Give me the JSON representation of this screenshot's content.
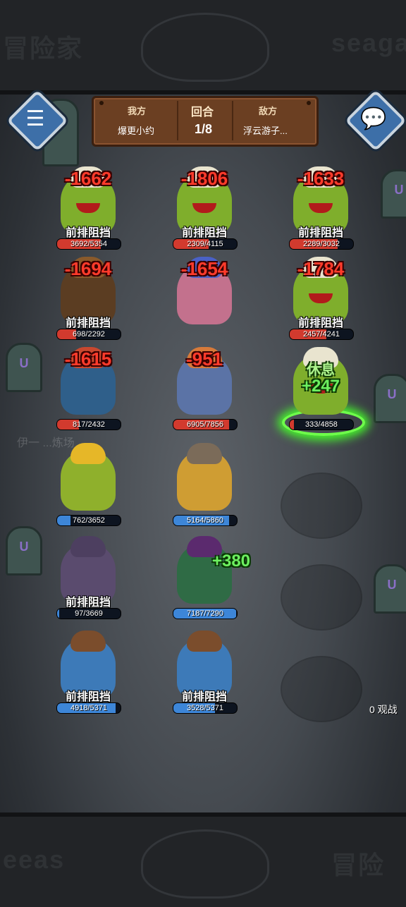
{
  "header": {
    "my_side_label": "我方",
    "round_label": "回合",
    "enemy_side_label": "敌方",
    "my_player": "爆更小约",
    "round_value": "1/8",
    "enemy_player": "浮云游子..."
  },
  "buttons": {
    "menu_icon": "menu-icon",
    "chat_icon": "chat-bubble-icon"
  },
  "spectators_label": "0 观战",
  "watermark_text": "伊一 ...炼场",
  "frame_text": {
    "left_top": "冒险家",
    "right_top": "seaga",
    "left_bottom": "eeas",
    "right_bottom": "冒险"
  },
  "status_texts": {
    "taunt": "前排阻挡",
    "rest": "休息"
  },
  "units": [
    {
      "id": "cactus-1",
      "col": 0,
      "row": 0,
      "type": "cactus",
      "damage": "-1662",
      "status": "前排阻挡",
      "hp_text": "3692/5354",
      "hp": 3692,
      "hp_max": 5354,
      "side": "enemy"
    },
    {
      "id": "cactus-2",
      "col": 1,
      "row": 0,
      "type": "cactus",
      "damage": "-1806",
      "status": "前排阻挡",
      "hp_text": "2309/4115",
      "hp": 2309,
      "hp_max": 4115,
      "side": "enemy"
    },
    {
      "id": "cactus-3",
      "col": 2,
      "row": 0,
      "type": "cactus",
      "damage": "-1633",
      "status": "前排阻挡",
      "hp_text": "2289/3032",
      "hp": 2289,
      "hp_max": 3032,
      "side": "enemy"
    },
    {
      "id": "cauldron",
      "col": 0,
      "row": 1,
      "type": "cauldron",
      "damage": "-1694",
      "status": "前排阻挡",
      "hp_text": "698/2292",
      "hp": 698,
      "hp_max": 2292,
      "side": "enemy"
    },
    {
      "id": "mermaid",
      "col": 1,
      "row": 1,
      "type": "mermaid",
      "damage": "-1654",
      "status": "",
      "hp_text": "",
      "hp": null,
      "hp_max": null,
      "side": "enemy"
    },
    {
      "id": "cactus-4",
      "col": 2,
      "row": 1,
      "type": "cactus",
      "damage": "-1784",
      "status": "前排阻挡",
      "hp_text": "2457/4241",
      "hp": 2457,
      "hp_max": 4241,
      "side": "enemy"
    },
    {
      "id": "diver",
      "col": 0,
      "row": 2,
      "type": "diver",
      "damage": "-1615",
      "status": "",
      "hp_text": "817/2432",
      "hp": 817,
      "hp_max": 2432,
      "side": "enemy"
    },
    {
      "id": "knight",
      "col": 1,
      "row": 2,
      "type": "knight",
      "damage": "-951",
      "status": "",
      "hp_text": "6905/7856",
      "hp": 6905,
      "hp_max": 7856,
      "side": "enemy"
    },
    {
      "id": "cactus-rest",
      "col": 2,
      "row": 2,
      "type": "cactus",
      "damage": "",
      "status": "",
      "hp_text": "333/4858",
      "hp": 333,
      "hp_max": 4858,
      "side": "enemy",
      "rest_label": "休息",
      "heal": "+247"
    },
    {
      "id": "plant",
      "col": 0,
      "row": 3,
      "type": "plant",
      "damage": "",
      "status": "",
      "hp_text": "762/3652",
      "hp": 762,
      "hp_max": 3652,
      "side": "ally"
    },
    {
      "id": "tower",
      "col": 1,
      "row": 3,
      "type": "tower",
      "damage": "",
      "status": "",
      "hp_text": "5164/5860",
      "hp": 5164,
      "hp_max": 5860,
      "side": "ally"
    },
    {
      "id": "golem",
      "col": 0,
      "row": 4,
      "type": "golem",
      "damage": "",
      "status": "前排阻挡",
      "hp_text": "97/3669",
      "hp": 97,
      "hp_max": 3669,
      "side": "ally"
    },
    {
      "id": "dark-knight",
      "col": 1,
      "row": 4,
      "type": "darkknight",
      "damage": "",
      "status": "",
      "hp_text": "7187/7290",
      "hp": 7187,
      "hp_max": 7290,
      "side": "ally",
      "heal": "+380"
    },
    {
      "id": "crab-1",
      "col": 0,
      "row": 5,
      "type": "crab",
      "damage": "",
      "status": "前排阻挡",
      "hp_text": "4918/5371",
      "hp": 4918,
      "hp_max": 5371,
      "side": "ally"
    },
    {
      "id": "crab-2",
      "col": 1,
      "row": 5,
      "type": "crab",
      "damage": "",
      "status": "前排阻挡",
      "hp_text": "3528/5371",
      "hp": 3528,
      "hp_max": 5371,
      "side": "ally"
    }
  ],
  "colors": {
    "enemy_hp": "#d23a2e",
    "ally_hp": "#3d86d8",
    "damage": "#ff3b2b",
    "heal": "#6df060",
    "board_wood": "#6b3f22"
  }
}
